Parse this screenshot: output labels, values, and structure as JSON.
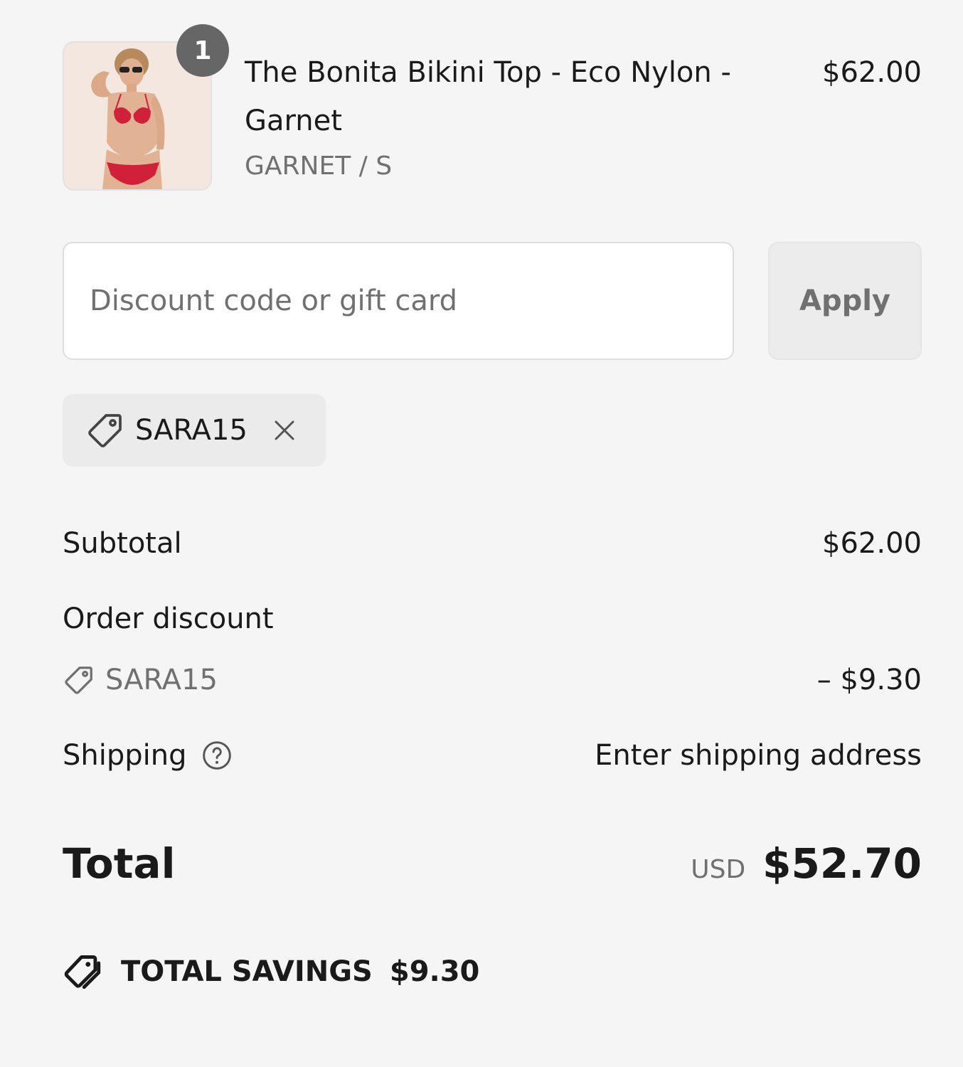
{
  "line_item": {
    "quantity": "1",
    "name": "The Bonita Bikini Top - Eco Nylon - Garnet",
    "variant": "GARNET / S",
    "price": "$62.00",
    "image_alt": "product-photo"
  },
  "discount": {
    "placeholder": "Discount code or gift card",
    "apply_label": "Apply",
    "applied_code": "SARA15"
  },
  "summary": {
    "subtotal_label": "Subtotal",
    "subtotal_value": "$62.00",
    "order_discount_label": "Order discount",
    "discount_code": "SARA15",
    "discount_value": "– $9.30",
    "shipping_label": "Shipping",
    "shipping_value": "Enter shipping address",
    "total_label": "Total",
    "total_currency": "USD",
    "total_value": "$52.70",
    "savings_label": "TOTAL SAVINGS",
    "savings_value": "$9.30"
  },
  "icons": {
    "tag": "tag-icon",
    "close": "close-icon",
    "help": "help-circle-icon",
    "savings": "tags-icon"
  },
  "colors": {
    "background": "#f5f5f5",
    "text": "#1a1a1a",
    "muted": "#707070",
    "badge": "#666666",
    "product_red": "#d0203a"
  }
}
